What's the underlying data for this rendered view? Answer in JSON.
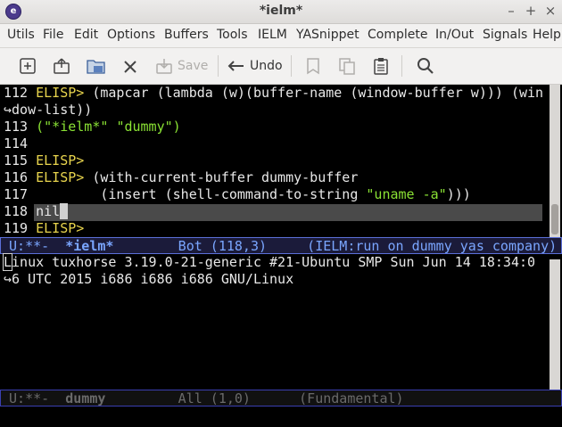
{
  "window": {
    "title": "*ielm*",
    "minimize": "–",
    "maximize": "+",
    "close": "×"
  },
  "menu": [
    "Utils",
    "File",
    "Edit",
    "Options",
    "Buffers",
    "Tools",
    "IELM",
    "YASnippet",
    "Complete",
    "In/Out",
    "Signals",
    "Help"
  ],
  "toolbar": {
    "save_label": "Save",
    "undo_label": "Undo",
    "icons": [
      "new-file-icon",
      "open-file-icon",
      "open-directory-icon",
      "close-icon",
      "save-icon",
      "undo-icon",
      "cut-icon",
      "copy-icon",
      "paste-icon",
      "search-icon"
    ]
  },
  "ielm": {
    "lines": [
      {
        "num": "112",
        "prompt": "ELISP>",
        "code": " (mapcar (lambda (w)(buffer-name (window-buffer w))) (win"
      },
      {
        "num": "",
        "cont": "dow-list))"
      },
      {
        "num": "113",
        "result_open": "(",
        "s1": "\"*ielm*\"",
        "sep": " ",
        "s2": "\"dummy\"",
        "result_close": ")"
      },
      {
        "num": "114"
      },
      {
        "num": "115",
        "prompt": "ELISP>"
      },
      {
        "num": "116",
        "prompt": "ELISP>",
        "code": " (with-current-buffer dummy-buffer"
      },
      {
        "num": "117",
        "code": "        (insert (shell-command-to-string ",
        "str": "\"uname -a\"",
        "tail": ")))"
      },
      {
        "num": "118",
        "text": "nil"
      },
      {
        "num": "119",
        "prompt": "ELISP>"
      }
    ],
    "modeline": {
      "status": " U:**-  ",
      "buffer": "*ielm*",
      "pos": "        Bot (118,3)     (IELM:run on dummy yas company)"
    }
  },
  "dummy": {
    "line1": "Linux tuxhorse 3.19.0-21-generic #21-Ubuntu SMP Sun Jun 14 18:34:0",
    "line2": "6 UTC 2015 i686 i686 i686 GNU/Linux",
    "modeline": {
      "status": " U:**-  ",
      "buffer": "dummy",
      "pos": "         All (1,0)      (Fundamental)"
    }
  },
  "colors": {
    "prompt": "#e8d44d",
    "string": "#8ae234",
    "modeline_active": "#7aa6ff",
    "modeline_inactive": "#6a6a6a"
  }
}
